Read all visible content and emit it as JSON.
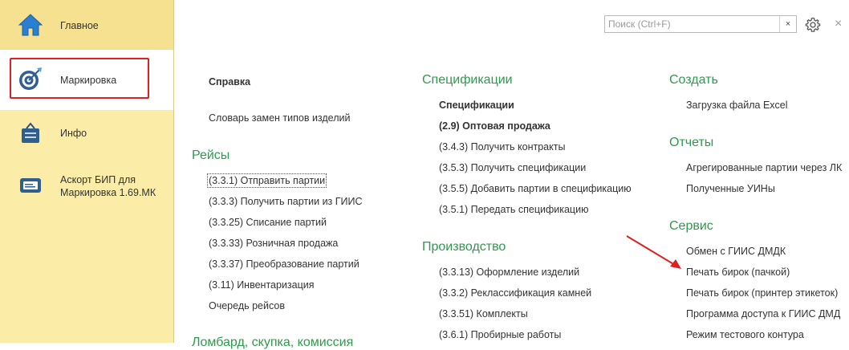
{
  "sidebar": {
    "items": [
      {
        "label": "Главное"
      },
      {
        "label": "Маркировка"
      },
      {
        "label": "Инфо"
      },
      {
        "label_line1": "Аскорт БИП для",
        "label_line2": "Маркировка 1.69.МК"
      }
    ]
  },
  "search": {
    "placeholder": "Поиск (Ctrl+F)",
    "clear": "×"
  },
  "close": "×",
  "columns": {
    "left": {
      "top_items": [
        "Справка",
        "Словарь замен типов изделий"
      ],
      "section_trips": "Рейсы",
      "trips": [
        "(3.3.1) Отправить партии",
        "(3.3.3) Получить партии из ГИИС",
        "(3.3.25) Списание партий",
        "(3.3.33) Розничная продажа",
        "(3.3.37) Преобразование партий",
        "(3.11) Инвентаризация",
        "Очередь рейсов"
      ],
      "section_pawn": "Ломбард, скупка, комиссия"
    },
    "middle": {
      "section_specs": "Спецификации",
      "specs": [
        "Спецификации",
        "(2.9) Оптовая продажа",
        "(3.4.3) Получить контракты",
        "(3.5.3) Получить спецификации",
        "(3.5.5) Добавить партии в спецификацию",
        "(3.5.1) Передать спецификацию"
      ],
      "section_production": "Производство",
      "production": [
        "(3.3.13) Оформление изделий",
        "(3.3.2) Реклассификация камней",
        "(3.3.51) Комплекты",
        "(3.6.1) Пробирные работы"
      ]
    },
    "right": {
      "section_create": "Создать",
      "create": [
        "Загрузка файла Excel"
      ],
      "section_reports": "Отчеты",
      "reports": [
        "Агрегированные партии через ЛК",
        "Полученные УИНы"
      ],
      "section_service": "Сервис",
      "service": [
        "Обмен с ГИИС ДМДК",
        "Печать бирок (пачкой)",
        "Печать бирок (принтер этикеток)",
        "Программа доступа к ГИИС ДМД",
        "Режим тестового контура"
      ]
    }
  },
  "colors": {
    "accent_green": "#2e9a4e",
    "sidebar_bg": "#fbeca7",
    "highlight_red": "#e02020"
  }
}
